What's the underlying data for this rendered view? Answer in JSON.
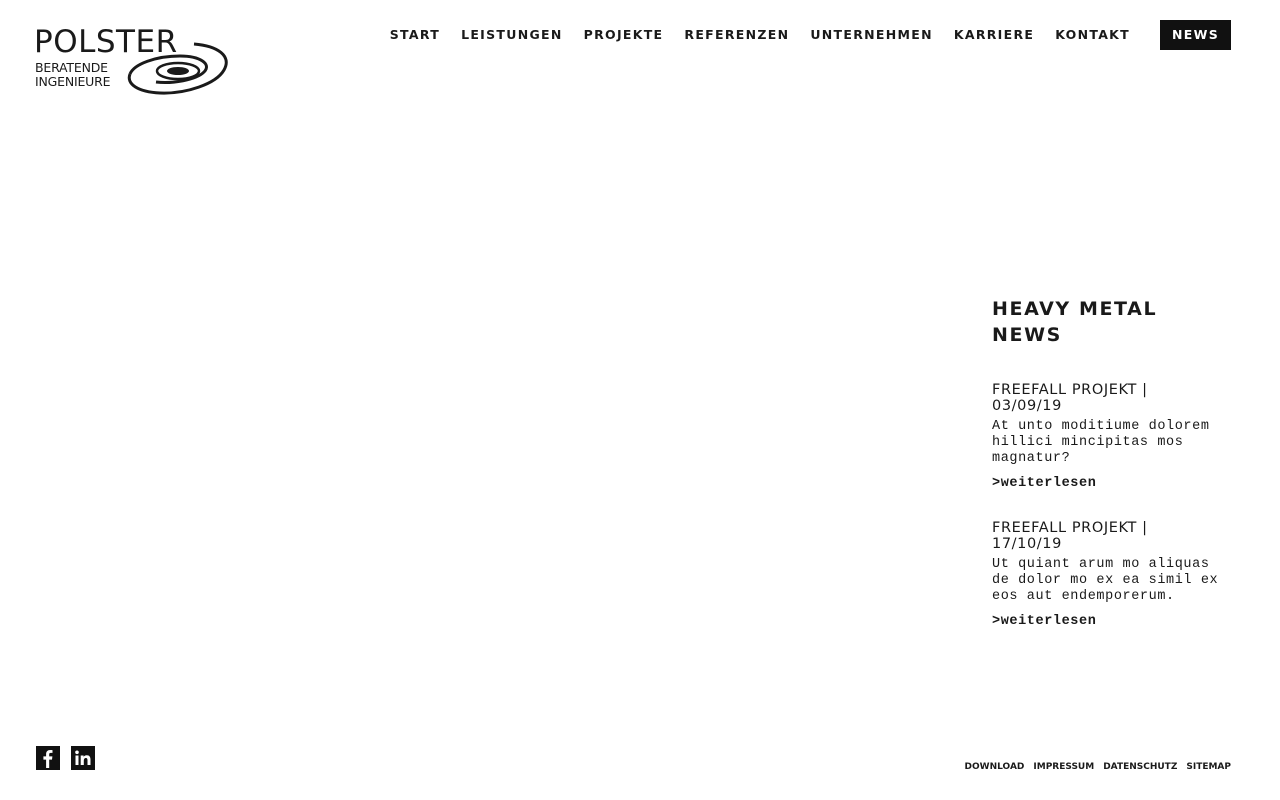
{
  "logo": {
    "wordmark": "POLSTER",
    "line1": "BERATENDE",
    "line2": "INGENIEURE"
  },
  "nav": {
    "items": [
      "START",
      "LEISTUNGEN",
      "PROJEKTE",
      "REFERENZEN",
      "UNTERNEHMEN",
      "KARRIERE",
      "KONTAKT"
    ],
    "news": "NEWS"
  },
  "news": {
    "heading": "HEAVY METAL NEWS",
    "items": [
      {
        "title": "FREEFALL PROJEKT | 03/09/19",
        "text": "At unto moditiume dolorem hillici mincipitas mos magnatur?",
        "more": ">weiterlesen"
      },
      {
        "title": "FREEFALL PROJEKT | 17/10/19",
        "text": "Ut quiant arum mo aliquas de dolor mo ex ea simil ex eos aut endemporerum.",
        "more": ">weiterlesen"
      }
    ]
  },
  "social": {
    "icons": [
      "facebook-icon",
      "linkedin-icon"
    ]
  },
  "footer": {
    "links": [
      "DOWNLOAD",
      "IMPRESSUM",
      "DATENSCHUTZ",
      "SITEMAP"
    ]
  },
  "colors": {
    "text": "#1a1a1a",
    "news_bg": "#111111",
    "background": "#ffffff"
  }
}
